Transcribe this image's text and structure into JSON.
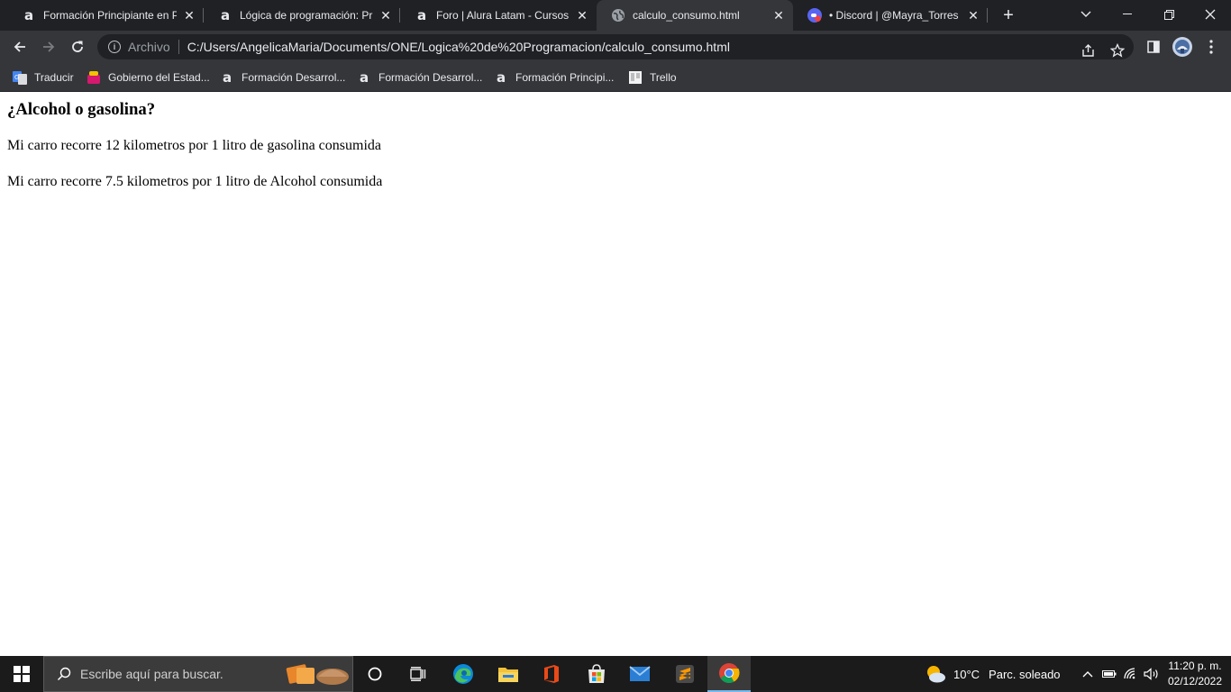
{
  "tabs": [
    {
      "title": "Formación Principiante en Pr",
      "favicon": "alura-icon",
      "active": false
    },
    {
      "title": "Lógica de programación: Prin",
      "favicon": "alura-icon",
      "active": false
    },
    {
      "title": "Foro | Alura Latam - Cursos o",
      "favicon": "alura-icon",
      "active": false
    },
    {
      "title": "calculo_consumo.html",
      "favicon": "globe-icon",
      "active": true
    },
    {
      "title": "• Discord | @Mayra_Torres cr",
      "favicon": "discord-icon",
      "active": false
    }
  ],
  "toolbar": {
    "scheme_label": "Archivo",
    "url": "C:/Users/AngelicaMaria/Documents/ONE/Logica%20de%20Programacion/calculo_consumo.html"
  },
  "bookmarks": [
    {
      "label": "Traducir",
      "icon": "google-translate-icon"
    },
    {
      "label": "Gobierno del Estad...",
      "icon": "gov-icon"
    },
    {
      "label": "Formación Desarrol...",
      "icon": "alura-icon"
    },
    {
      "label": "Formación Desarrol...",
      "icon": "alura-icon"
    },
    {
      "label": "Formación Principi...",
      "icon": "alura-icon"
    },
    {
      "label": "Trello",
      "icon": "trello-icon"
    }
  ],
  "page": {
    "heading": "¿Alcohol o gasolina?",
    "line1": "Mi carro recorre 12 kilometros por 1 litro de gasolina consumida",
    "line2": "Mi carro recorre 7.5 kilometros por 1 litro de Alcohol consumida"
  },
  "taskbar": {
    "search_placeholder": "Escribe aquí para buscar.",
    "weather_temp": "10°C",
    "weather_desc": "Parc. soleado",
    "time": "11:20 p. m.",
    "date": "02/12/2022"
  },
  "colors": {
    "chrome_dark": "#202124",
    "chrome_toolbar": "#35363a",
    "taskbar": "#1b1b1b"
  }
}
